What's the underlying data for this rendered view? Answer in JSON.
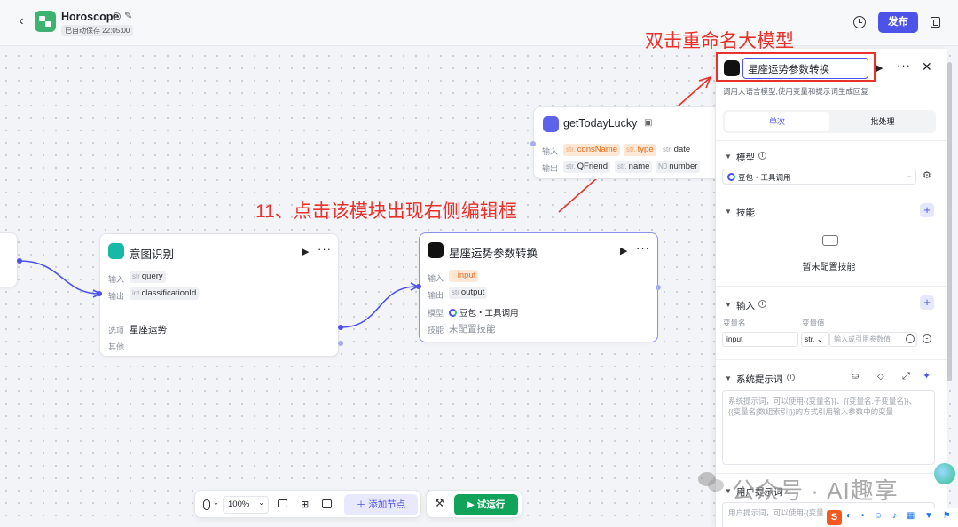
{
  "header": {
    "title": "Horoscope",
    "autosave": "已自动保存 22:05:00",
    "publish": "发布"
  },
  "annotations": {
    "rename": "双击重命名大模型",
    "step": "11、点击该模块出现右侧编辑框"
  },
  "nodes": {
    "lucky": {
      "title": "getTodayLucky",
      "input_label": "输入",
      "output_label": "输出",
      "inputs": [
        {
          "type": "str",
          "name": "consName",
          "highlight": true
        },
        {
          "type": "str",
          "name": "type",
          "highlight": true
        },
        {
          "type": "str",
          "name": "date",
          "highlight": false
        }
      ],
      "outputs": [
        {
          "type": "str",
          "name": "QFriend"
        },
        {
          "type": "str",
          "name": "name"
        },
        {
          "type": "N0",
          "name": "number"
        }
      ]
    },
    "intent": {
      "title": "意图识别",
      "input_label": "输入",
      "output_label": "输出",
      "input": {
        "type": "str",
        "name": "query"
      },
      "output": {
        "type": "int",
        "name": "classificationId"
      },
      "option_label": "选项",
      "option_value": "星座运势",
      "other_label": "其他"
    },
    "llm": {
      "title": "星座运势参数转换",
      "input_label": "输入",
      "output_label": "输出",
      "model_label": "模型",
      "skill_label": "技能",
      "input": {
        "type": "",
        "name": "input"
      },
      "output": {
        "type": "str",
        "name": "output"
      },
      "model_value": "豆包・工具调用",
      "skill_value": "未配置技能"
    }
  },
  "panel": {
    "name_value": "星座运势参数转换",
    "description": "调用大语言模型,使用变量和提示词生成回复",
    "tabs": [
      "单次",
      "批处理"
    ],
    "model_title": "模型",
    "model_value": "豆包・工具调用",
    "skills_title": "技能",
    "skills_empty": "暂未配置技能",
    "input_title": "输入",
    "var_name_header": "变量名",
    "var_value_header": "变量值",
    "var_name": "input",
    "var_type": "str.",
    "var_value_placeholder": "输入或引用参数值",
    "system_prompt_title": "系统提示词",
    "system_prompt_placeholder": "系统提示词，可以使用{{变量名}}、{{变量名.子变量名}}、{{变量名[数组索引]}}的方式引用输入参数中的变量",
    "user_prompt_title": "用户提示词",
    "user_prompt_placeholder": "用户提示词，可以使用{{变量名}}"
  },
  "toolbar": {
    "zoom": "100%",
    "add_node": "添加节点",
    "run": "试运行"
  },
  "watermark": "公众号 · AI趣享",
  "colors": {
    "accent": "#4d53e8",
    "run_green": "#12a35a",
    "annotation_red": "#e8312a",
    "input_highlight": "#fde7d6"
  }
}
